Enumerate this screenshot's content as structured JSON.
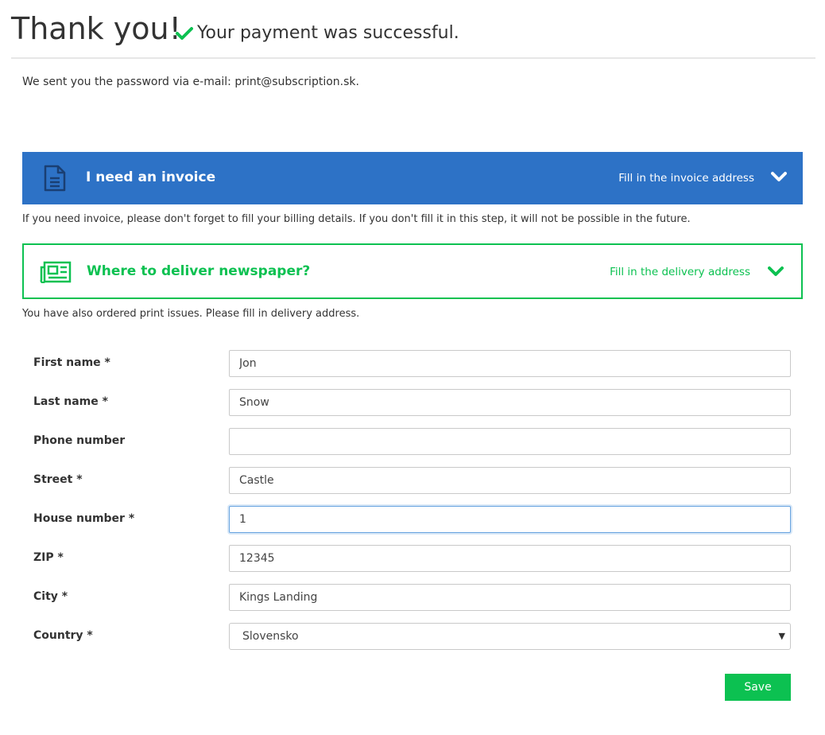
{
  "header": {
    "title": "Thank you!",
    "subtitle": "Your payment was successful."
  },
  "notice": "We sent you the password via e-mail: print@subscription.sk.",
  "invoice_panel": {
    "title": "I need an invoice",
    "action": "Fill in the invoice address",
    "note": "If you need invoice, please don't forget to fill your billing details. If you don't fill it in this step, it will not be possible in the future."
  },
  "delivery_panel": {
    "title": "Where to deliver newspaper?",
    "action": "Fill in the delivery address",
    "note": "You have also ordered print issues. Please fill in delivery address."
  },
  "form": {
    "first_name": {
      "label": "First name *",
      "value": "Jon"
    },
    "last_name": {
      "label": "Last name *",
      "value": "Snow"
    },
    "phone": {
      "label": "Phone number",
      "value": ""
    },
    "street": {
      "label": "Street *",
      "value": "Castle"
    },
    "house_number": {
      "label": "House number *",
      "value": "1"
    },
    "zip": {
      "label": "ZIP *",
      "value": "12345"
    },
    "city": {
      "label": "City *",
      "value": "Kings Landing"
    },
    "country": {
      "label": "Country *",
      "value": "Slovensko"
    },
    "save_label": "Save"
  },
  "colors": {
    "invoice_blue": "#2d72c6",
    "delivery_green": "#0cc151",
    "success_check": "#0cc151"
  },
  "icons": {
    "success": "check-icon",
    "invoice": "document-icon",
    "delivery": "newspaper-icon",
    "expand": "chevron-down-icon"
  }
}
